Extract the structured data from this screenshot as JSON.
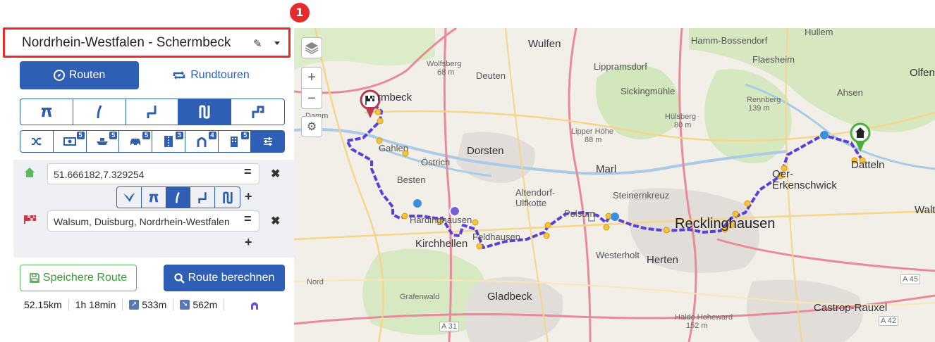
{
  "header": {
    "title": "Nordrhein-Westfalen - Schermbeck",
    "badge": "1"
  },
  "tabs": [
    {
      "label": "Routen"
    },
    {
      "label": "Rundtouren"
    }
  ],
  "profiles": {
    "badges": [
      "5",
      "5",
      "5",
      "3",
      "4",
      "5"
    ]
  },
  "waypoints": [
    {
      "value": "51.666182,7.329254",
      "icon": "home-icon"
    },
    {
      "value": "Walsum, Duisburg, Nordrhein-Westfalen",
      "icon": "finish-flag-icon"
    }
  ],
  "buttons": {
    "save": "Speichere Route",
    "calc": "Route berechnen"
  },
  "stats": {
    "distance": "52.15km",
    "time": "1h 18min",
    "ascent": "533m",
    "descent": "562m"
  },
  "map": {
    "labels": [
      "Hullem",
      "Wulfen",
      "Hamm-Bossendorf",
      "Flaesheim",
      "Olfen",
      "Wolfsberg",
      "68 m",
      "Deuten",
      "Lippramsdorf",
      "Sickingmühle",
      "Ahsen",
      "Rennberg",
      "139 m",
      "rmbeck",
      "Damm",
      "Hülsberg",
      "80 m",
      "Lipper Höhe",
      "88 m",
      "Dorsten",
      "Datteln",
      "Gahlen",
      "Östrich",
      "Marl",
      "Oer-Erkenschwick",
      "Besten",
      "Altendorf-Ulfkotte",
      "Steinernkreuz",
      "Walt",
      "Polsum",
      "Hardinghausen",
      "Feldhausen",
      "Recklinghausen",
      "Kirchhellen",
      "Westerholt",
      "Herten",
      "Gladbeck",
      "Grafenwald",
      "Halde Hoheward",
      "152 m",
      "Castrop-Rauxel",
      "A 31",
      "A 42",
      "A 45",
      "Nord"
    ]
  },
  "colors": {
    "primary": "#2e5fb5",
    "highlight": "#e52b2b",
    "route": "#5b3fd6",
    "save": "#5cb85c"
  }
}
